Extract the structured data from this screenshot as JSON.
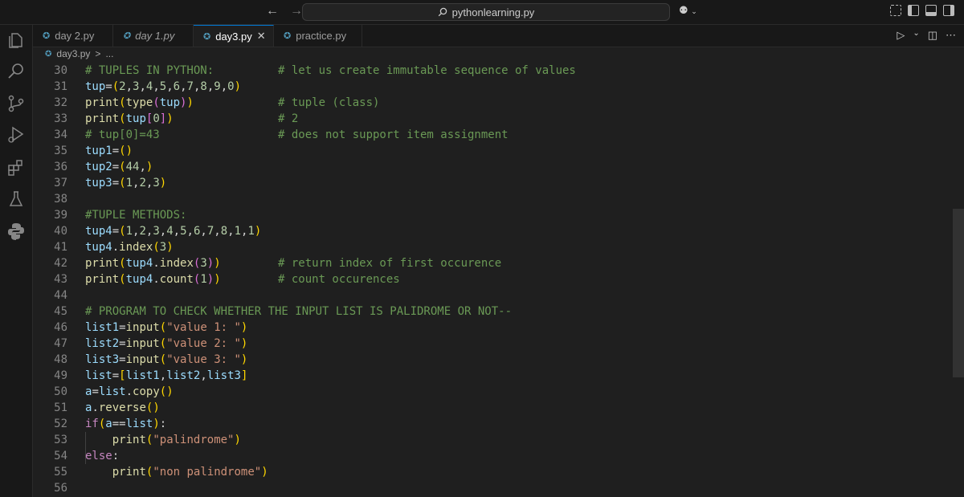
{
  "window": {
    "command_center": "pythonlearning.py"
  },
  "activity_bar": [
    "explorer-icon",
    "search-icon",
    "source-control-icon",
    "run-debug-icon",
    "extensions-icon",
    "testing-icon",
    "python-icon"
  ],
  "tabs": [
    {
      "label": "day 2.py",
      "italic": false
    },
    {
      "label": "day 1.py",
      "italic": true
    },
    {
      "label": "day3.py",
      "active": true
    },
    {
      "label": "practice.py"
    }
  ],
  "breadcrumb": {
    "file": "day3.py",
    "separator": ">",
    "more": "..."
  },
  "code": {
    "lines": [
      {
        "n": "30",
        "text": "# TUPLES IN PYTHON:",
        "comment": "# let us create immutable sequence of values"
      },
      {
        "n": "31",
        "text": "tup=(2,3,4,5,6,7,8,9,0)",
        "comment": ""
      },
      {
        "n": "32",
        "text": "print(type(tup))",
        "comment": "# tuple (class)"
      },
      {
        "n": "33",
        "text": "print(tup[0])",
        "comment": "# 2"
      },
      {
        "n": "34",
        "text": "# tup[0]=43",
        "comment": "# does not support item assignment"
      },
      {
        "n": "35",
        "text": "tup1=()",
        "comment": ""
      },
      {
        "n": "36",
        "text": "tup2=(44,)",
        "comment": ""
      },
      {
        "n": "37",
        "text": "tup3=(1,2,3)",
        "comment": ""
      },
      {
        "n": "38",
        "text": "",
        "comment": ""
      },
      {
        "n": "39",
        "text": "#TUPLE METHODS:",
        "comment": ""
      },
      {
        "n": "40",
        "text": "tup4=(1,2,3,4,5,6,7,8,1,1)",
        "comment": ""
      },
      {
        "n": "41",
        "text": "tup4.index(3)",
        "comment": ""
      },
      {
        "n": "42",
        "text": "print(tup4.index(3))",
        "comment": "# return index of first occurence"
      },
      {
        "n": "43",
        "text": "print(tup4.count(1))",
        "comment": "# count occurences"
      },
      {
        "n": "44",
        "text": "",
        "comment": ""
      },
      {
        "n": "45",
        "text": "# PROGRAM TO CHECK WHETHER THE INPUT LIST IS PALIDROME OR NOT--",
        "comment": ""
      },
      {
        "n": "46",
        "text": "list1=input(\"value 1: \")",
        "comment": ""
      },
      {
        "n": "47",
        "text": "list2=input(\"value 2: \")",
        "comment": ""
      },
      {
        "n": "48",
        "text": "list3=input(\"value 3: \")",
        "comment": ""
      },
      {
        "n": "49",
        "text": "list=[list1,list2,list3]",
        "comment": ""
      },
      {
        "n": "50",
        "text": "a=list.copy()",
        "comment": ""
      },
      {
        "n": "51",
        "text": "a.reverse()",
        "comment": ""
      },
      {
        "n": "52",
        "text": "if(a==list):",
        "comment": ""
      },
      {
        "n": "53",
        "text": "    print(\"palindrome\")",
        "comment": ""
      },
      {
        "n": "54",
        "text": "else:",
        "comment": ""
      },
      {
        "n": "55",
        "text": "    print(\"non palindrome\")",
        "comment": ""
      },
      {
        "n": "56",
        "text": "",
        "comment": ""
      }
    ]
  }
}
